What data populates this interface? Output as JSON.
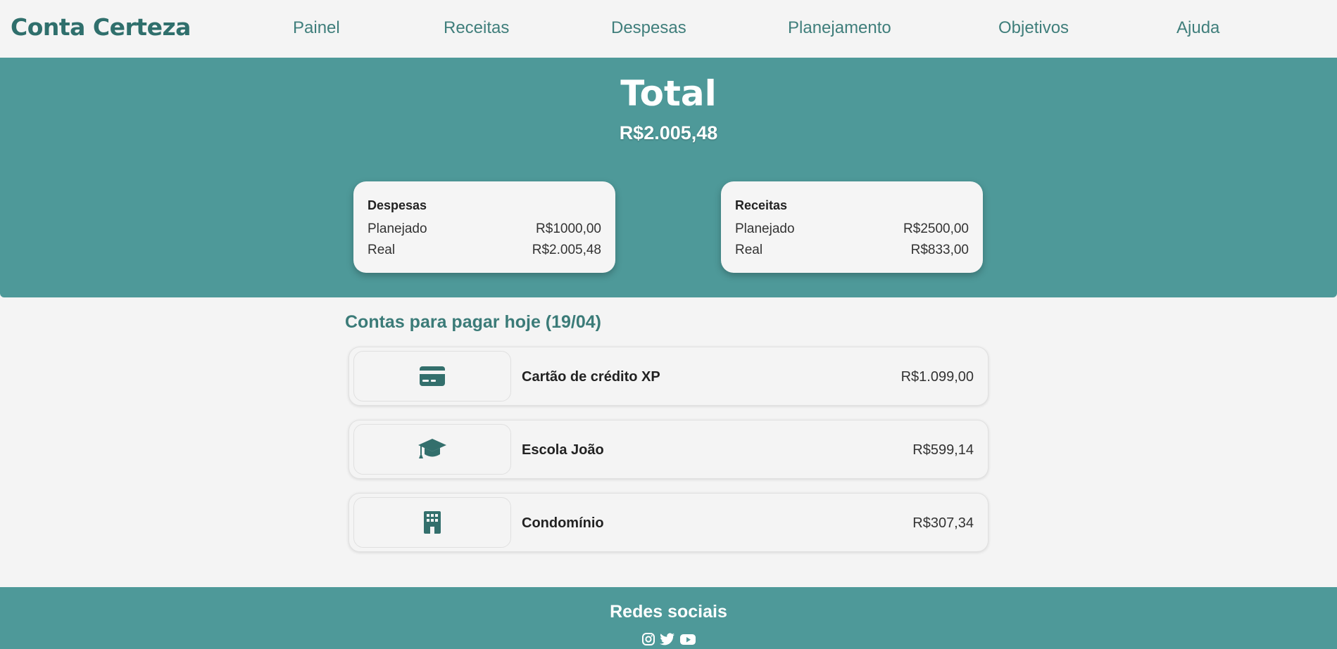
{
  "header": {
    "logo": "Conta Certeza",
    "nav": [
      "Painel",
      "Receitas",
      "Despesas",
      "Planejamento",
      "Objetivos",
      "Ajuda"
    ]
  },
  "hero": {
    "title": "Total",
    "total": "R$2.005,48",
    "cards": [
      {
        "title": "Despesas",
        "rows": [
          {
            "label": "Planejado",
            "value": "R$1000,00"
          },
          {
            "label": "Real",
            "value": "R$2.005,48"
          }
        ]
      },
      {
        "title": "Receitas",
        "rows": [
          {
            "label": "Planejado",
            "value": "R$2500,00"
          },
          {
            "label": "Real",
            "value": "R$833,00"
          }
        ]
      }
    ]
  },
  "bills": {
    "heading": "Contas para pagar hoje (19/04)",
    "items": [
      {
        "icon": "credit-card-icon",
        "name": "Cartão de crédito XP",
        "amount": "R$1.099,00"
      },
      {
        "icon": "graduation-cap-icon",
        "name": "Escola João",
        "amount": "R$599,14"
      },
      {
        "icon": "building-icon",
        "name": "Condomínio",
        "amount": "R$307,34"
      }
    ]
  },
  "footer": {
    "title": "Redes sociais",
    "socials": [
      "instagram-icon",
      "twitter-icon",
      "youtube-icon"
    ]
  },
  "colors": {
    "primary": "#4e9999",
    "accent_dark": "#2f6f6c",
    "background": "#f4f4f4"
  }
}
